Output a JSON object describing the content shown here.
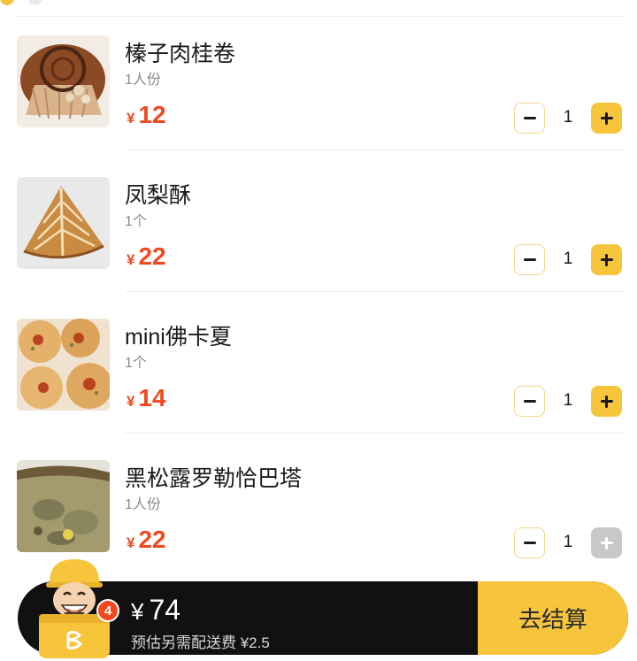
{
  "items": [
    {
      "name": "榛子肉桂卷",
      "unit": "1人份",
      "currency": "¥",
      "price": "12",
      "quantity": "1",
      "plus_enabled": true
    },
    {
      "name": "凤梨酥",
      "unit": "1个",
      "currency": "¥",
      "price": "22",
      "quantity": "1",
      "plus_enabled": true
    },
    {
      "name": "mini佛卡夏",
      "unit": "1个",
      "currency": "¥",
      "price": "14",
      "quantity": "1",
      "plus_enabled": true
    },
    {
      "name": "黑松露罗勒恰巴塔",
      "unit": "1人份",
      "currency": "¥",
      "price": "22",
      "quantity": "1",
      "plus_enabled": false
    }
  ],
  "cart": {
    "badge_count": "4",
    "currency": "¥",
    "total": "74",
    "delivery_note": "预估另需配送费 ¥2.5",
    "checkout_label": "去结算"
  },
  "colors": {
    "accent": "#f7c53c",
    "price": "#f0491f",
    "bar": "#111111"
  }
}
